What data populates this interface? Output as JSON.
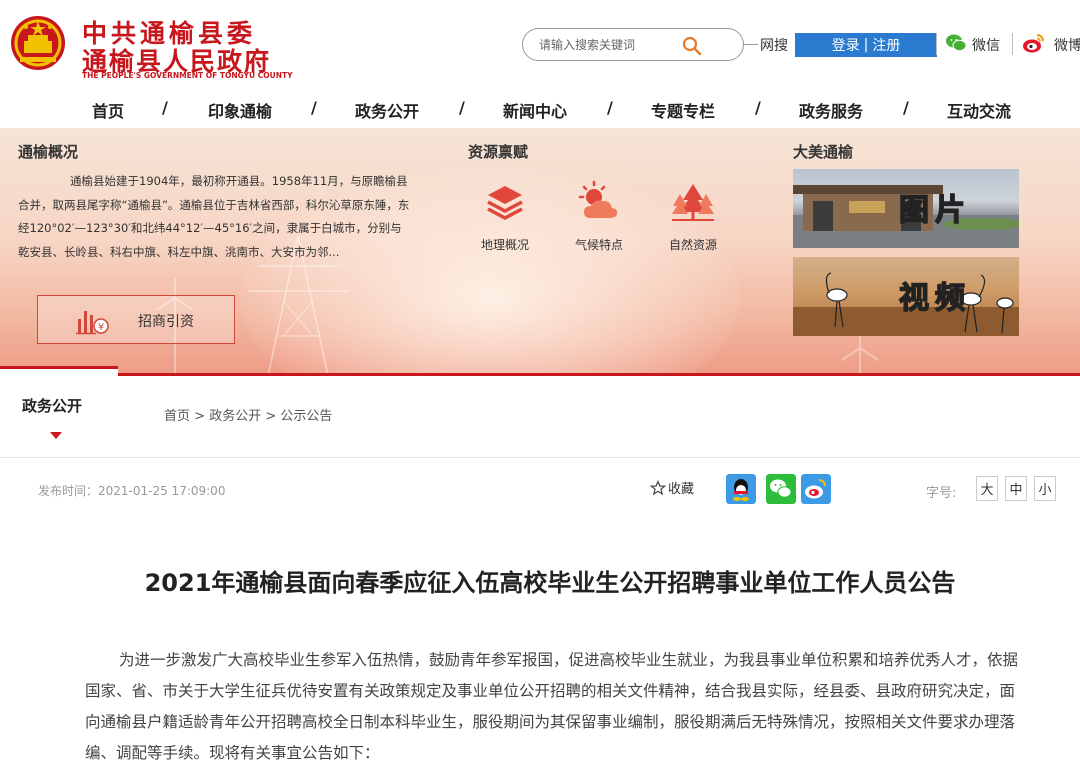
{
  "header": {
    "logo_line1": "中共通榆县委",
    "logo_line2": "通榆县人民政府",
    "logo_en": "THE PEOPLE'S GOVERNMENT OF TONGYU COUNTY",
    "search_placeholder": "请输入搜索关键词",
    "search_scope": "网搜",
    "login_label": "登录",
    "register_label": "注册",
    "wechat_label": "微信",
    "weibo_label": "微博"
  },
  "nav": {
    "items": [
      "首页",
      "印象通榆",
      "政务公开",
      "新闻中心",
      "专题专栏",
      "政务服务",
      "互动交流"
    ]
  },
  "banner": {
    "about": {
      "title": "通榆概况",
      "text": "通榆县始建于1904年，最初称开通县。1958年11月，与原瞻榆县合并，取两县尾字称“通榆县”。通榆县位于吉林省西部，科尔沁草原东陲，东经120°02′—123°30′和北纬44°12′—45°16′之间，隶属于白城市，分别与乾安县、长岭县、科右中旗、科左中旗、洮南市、大安市为邻...",
      "invest_label": "招商引资"
    },
    "resources": {
      "title": "资源禀赋",
      "items": [
        "地理概况",
        "气候特点",
        "自然资源"
      ]
    },
    "media": {
      "title": "大美通榆",
      "photo_label": "图片",
      "video_label": "视频"
    }
  },
  "subnav": {
    "section_label": "政务公开",
    "breadcrumb": [
      "首页",
      "政务公开",
      "公示公告"
    ],
    "breadcrumb_sep": ">"
  },
  "info": {
    "publish_time": "发布时间：2021-01-25 17:09:00",
    "favorite_label": "收藏",
    "font_size_label": "字号:",
    "font_sizes": [
      "大",
      "中",
      "小"
    ]
  },
  "article": {
    "title": "2021年通榆县面向春季应征入伍高校毕业生公开招聘事业单位工作人员公告",
    "body": "为进一步激发广大高校毕业生参军入伍热情，鼓励青年参军报国，促进高校毕业生就业，为我县事业单位积累和培养优秀人才，依据国家、省、市关于大学生征兵优待安置有关政策规定及事业单位公开招聘的相关文件精神，结合我县实际，经县委、县政府研究决定，面向通榆县户籍适龄青年公开招聘高校全日制本科毕业生，服役期间为其保留事业编制，服役期满后无特殊情况，按照相关文件要求办理落编、调配等手续。现将有关事宜公告如下："
  },
  "colors": {
    "brand_red": "#c8161d",
    "login_blue": "#2a7bd0"
  }
}
